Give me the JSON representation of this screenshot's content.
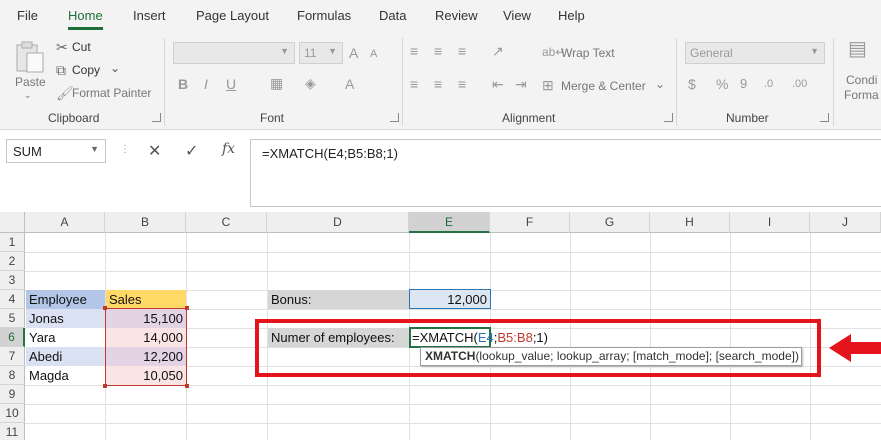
{
  "menu_tabs": [
    "File",
    "Home",
    "Insert",
    "Page Layout",
    "Formulas",
    "Data",
    "Review",
    "View",
    "Help"
  ],
  "active_tab": "Home",
  "ribbon": {
    "clipboard": {
      "paste": "Paste",
      "cut": "Cut",
      "copy": "Copy",
      "format_painter": "Format Painter",
      "label": "Clipboard"
    },
    "font": {
      "font_name": "",
      "font_size": "11",
      "label": "Font"
    },
    "alignment": {
      "wrap_text": "Wrap Text",
      "merge_center": "Merge & Center",
      "label": "Alignment"
    },
    "number": {
      "format": "General",
      "label": "Number"
    },
    "styles": {
      "conditional_line1": "Condi",
      "conditional_line2": "Forma"
    }
  },
  "formula_bar": {
    "name_box": "SUM",
    "cancel_icon": "✕",
    "enter_icon": "✓",
    "fx_icon": "fx",
    "formula": "=XMATCH(E4;B5:B8;1)"
  },
  "columns": [
    "A",
    "B",
    "C",
    "D",
    "E",
    "F",
    "G",
    "H",
    "I",
    "J"
  ],
  "rows": [
    "1",
    "2",
    "3",
    "4",
    "5",
    "6",
    "7",
    "8",
    "9",
    "10",
    "11"
  ],
  "cells": {
    "A4": "Employee",
    "B4": "Sales",
    "A5": "Jonas",
    "B5": "15,100",
    "A6": "Yara",
    "B6": "14,000",
    "A7": "Abedi",
    "B7": "12,200",
    "A8": "Magda",
    "B8": "10,050",
    "D4": "Bonus:",
    "E4": "12,000",
    "D6": "Numer of employees:"
  },
  "active_cell_formula": {
    "prefix": "=XMATCH(",
    "ref1": "E4",
    "sep1": ";",
    "ref2": "B5:B8",
    "suffix": ";1)"
  },
  "autocomplete_tooltip": {
    "function_name": "XMATCH",
    "args": "(lookup_value; lookup_array; [match_mode]; [search_mode])"
  },
  "colors": {
    "accent_green": "#217346",
    "callout_red": "#e5141c",
    "header_blue_fill": "#b4c6e7",
    "header_yellow_fill": "#ffd966",
    "ref1_color": "#2e75b6",
    "ref2_color": "#c0392b"
  }
}
